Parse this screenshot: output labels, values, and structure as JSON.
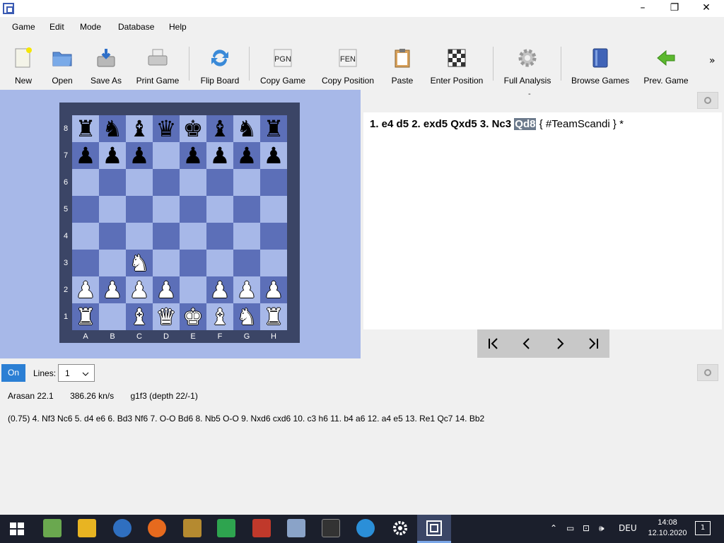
{
  "window": {
    "minimize": "–",
    "maximize": "❐",
    "close": "✕"
  },
  "menu": [
    "Game",
    "Edit",
    "Mode",
    "Database",
    "Help"
  ],
  "toolbar": {
    "items": [
      {
        "label": "New",
        "icon": "new-document-icon"
      },
      {
        "label": "Open",
        "icon": "open-folder-icon"
      },
      {
        "label": "Save As",
        "icon": "save-icon"
      },
      {
        "label": "Print Game",
        "icon": "printer-icon"
      },
      {
        "label": "Flip Board",
        "icon": "flip-icon"
      },
      {
        "label": "Copy Game",
        "icon": "pgn-icon",
        "text": "PGN"
      },
      {
        "label": "Copy Position",
        "icon": "fen-icon",
        "text": "FEN"
      },
      {
        "label": "Paste",
        "icon": "clipboard-icon"
      },
      {
        "label": "Enter Position",
        "icon": "board-icon"
      },
      {
        "label": "Full Analysis",
        "icon": "gear-icon"
      },
      {
        "label": "Browse Games",
        "icon": "book-icon"
      },
      {
        "label": "Prev. Game",
        "icon": "arrow-left-icon"
      }
    ],
    "more": "»"
  },
  "board": {
    "ranks": [
      "8",
      "7",
      "6",
      "5",
      "4",
      "3",
      "2",
      "1"
    ],
    "files": [
      "A",
      "B",
      "C",
      "D",
      "E",
      "F",
      "G",
      "H"
    ],
    "rows": [
      [
        "r",
        "n",
        "b",
        "q",
        "k",
        "b",
        "n",
        "r"
      ],
      [
        "p",
        "p",
        "p",
        "",
        "p",
        "p",
        "p",
        "p"
      ],
      [
        "",
        "",
        "",
        "",
        "",
        "",
        "",
        ""
      ],
      [
        "",
        "",
        "",
        "",
        "",
        "",
        "",
        ""
      ],
      [
        "",
        "",
        "",
        "",
        "",
        "",
        "",
        ""
      ],
      [
        "",
        "",
        "N",
        "",
        "",
        "",
        "",
        ""
      ],
      [
        "P",
        "P",
        "P",
        "P",
        "",
        "P",
        "P",
        "P"
      ],
      [
        "R",
        "",
        "B",
        "Q",
        "K",
        "B",
        "N",
        "R"
      ]
    ]
  },
  "notation": {
    "header_mark": "-",
    "moves_before": "1. e4 d5 2. exd5 Qxd5 3. Nc3",
    "current_move": "Qd8",
    "comment": "{ #TeamScandi }",
    "result": "*",
    "nav": [
      "|<",
      "<",
      ">",
      ">|"
    ]
  },
  "analysis": {
    "toggle": "On",
    "lines_label": "Lines:",
    "lines_value": "1",
    "engine": "Arasan 22.1",
    "speed": "386.26 kn/s",
    "current": "g1f3 (depth 22/-1)",
    "pv": "(0.75)  4. Nf3 Nc6 5. d4 e6 6. Bd3 Nf6 7. O-O Bd6 8. Nb5 O-O 9. Nxd6 cxd6 10. c3 h6 11. b4 a6 12. a4 e5 13. Re1 Qc7 14. Bb2"
  },
  "taskbar": {
    "lang": "DEU",
    "time": "14:08",
    "date": "12.10.2020",
    "notifications": "1"
  },
  "colors": {
    "board_light": "#a7b8e8",
    "board_dark": "#5c6fb8",
    "board_frame": "#3b4566",
    "accent": "#2b7fd4"
  }
}
